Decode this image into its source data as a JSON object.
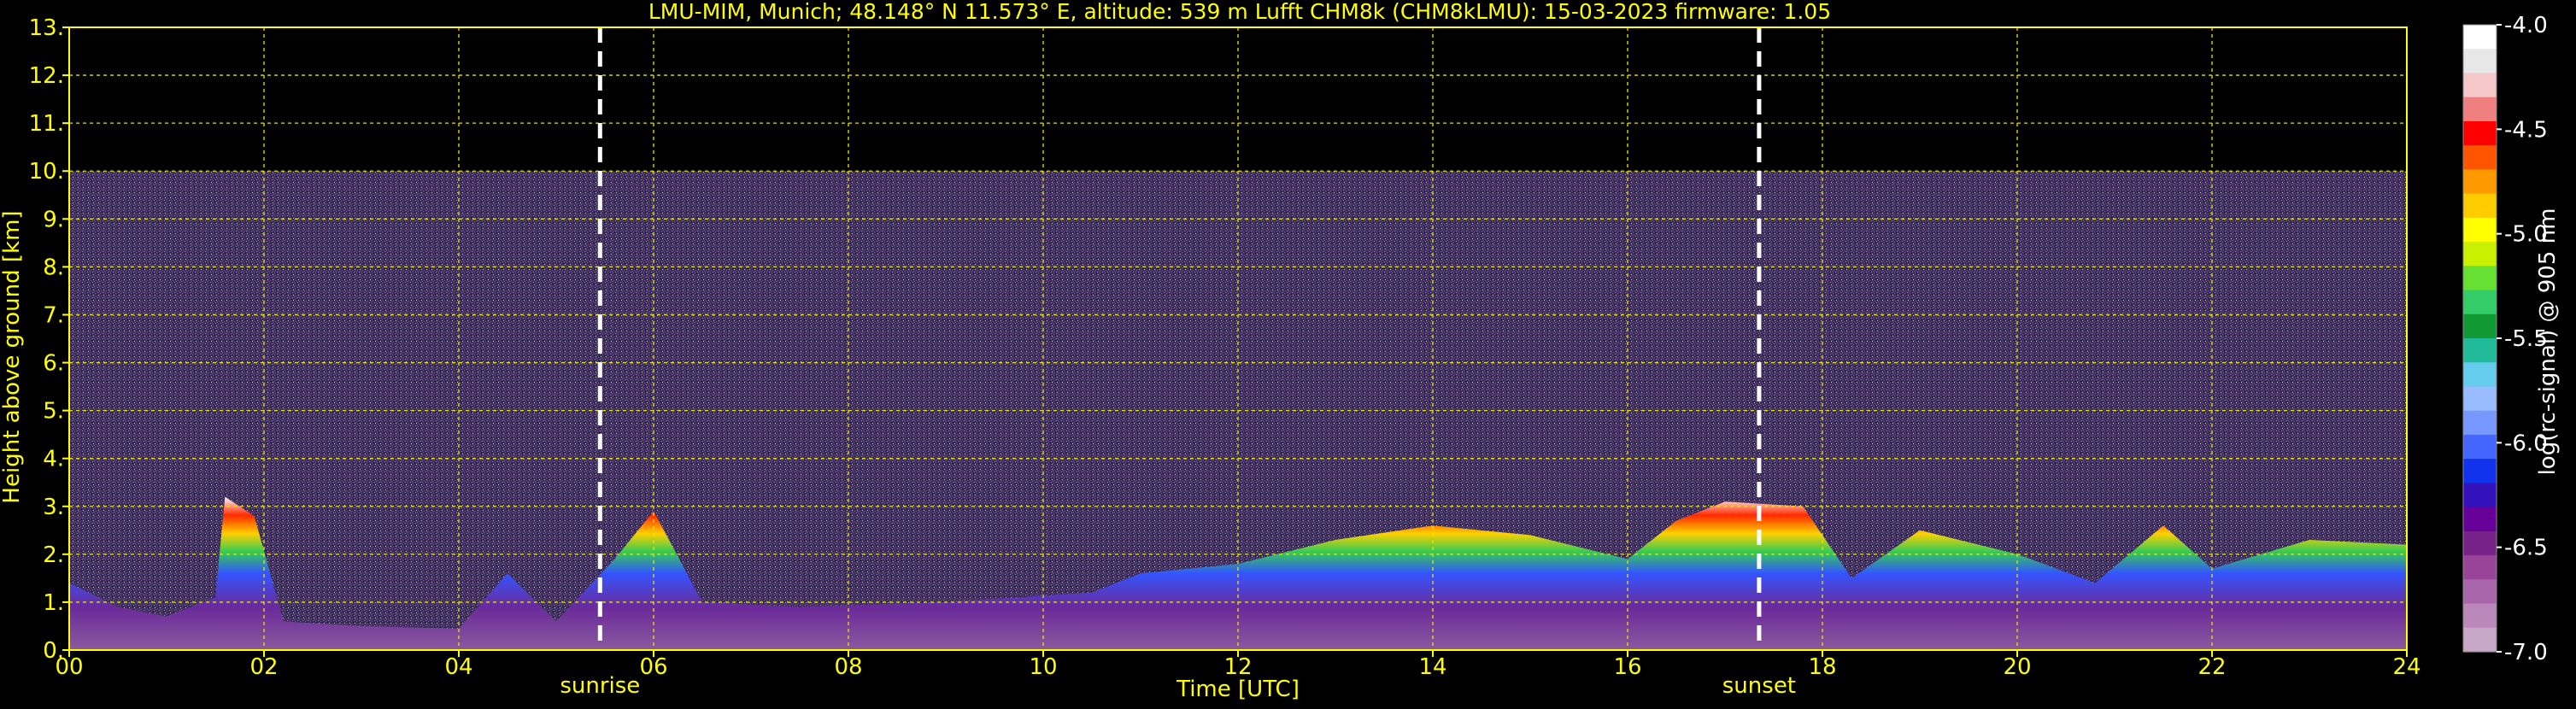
{
  "chart_data": {
    "type": "heatmap",
    "title": "LMU-MIM, Munich; 48.148° N 11.573° E, altitude: 539 m    Lufft CHM8k (CHM8kLMU): 15-03-2023    firmware: 1.05",
    "xlabel": "Time [UTC]",
    "ylabel": "Height above ground [km]",
    "xlim": [
      0,
      24
    ],
    "ylim": [
      0,
      13
    ],
    "x_ticks": [
      "00",
      "02",
      "04",
      "06",
      "08",
      "10",
      "12",
      "14",
      "16",
      "18",
      "20",
      "22",
      "24"
    ],
    "y_ticks": [
      "0.",
      "1.",
      "2.",
      "3.",
      "4.",
      "5.",
      "6.",
      "7.",
      "8.",
      "9.",
      "10.",
      "11.",
      "12.",
      "13."
    ],
    "grid": true,
    "grid_color": "#e6e600",
    "text_color": "#ffff00",
    "background": "#000000",
    "signal_top_km": 10,
    "annotations": [
      {
        "label": "sunrise",
        "x": 5.45
      },
      {
        "label": "sunset",
        "x": 17.35
      }
    ],
    "colorbar": {
      "label": "log(rc-signal) @ 905 nm",
      "range": [
        -7.0,
        -4.0
      ],
      "ticks": [
        "-4.0",
        "-4.5",
        "-5.0",
        "-5.5",
        "-6.0",
        "-6.5",
        "-7.0"
      ],
      "colors": [
        "#ffffff",
        "#e8e8e8",
        "#f4c8c8",
        "#f08080",
        "#ff0000",
        "#ff5500",
        "#ff9900",
        "#ffcc00",
        "#ffff00",
        "#c8f000",
        "#66e033",
        "#33cc66",
        "#119933",
        "#22bb99",
        "#66ccee",
        "#99bbff",
        "#7799ff",
        "#4466ff",
        "#1133ee",
        "#3311bb",
        "#660099",
        "#772288",
        "#994499",
        "#aa66aa",
        "#bb88bb",
        "#c8a8c8"
      ]
    },
    "boundary_layer_profile": [
      {
        "x": 0.0,
        "top": 1.4
      },
      {
        "x": 0.5,
        "top": 0.9
      },
      {
        "x": 1.0,
        "top": 0.7
      },
      {
        "x": 1.5,
        "top": 1.1
      },
      {
        "x": 1.6,
        "top": 3.2
      },
      {
        "x": 1.9,
        "top": 2.8
      },
      {
        "x": 2.2,
        "top": 0.6
      },
      {
        "x": 3.0,
        "top": 0.5
      },
      {
        "x": 4.0,
        "top": 0.45
      },
      {
        "x": 4.5,
        "top": 1.6
      },
      {
        "x": 5.0,
        "top": 0.6
      },
      {
        "x": 5.6,
        "top": 1.9
      },
      {
        "x": 6.0,
        "top": 2.9
      },
      {
        "x": 6.5,
        "top": 1.0
      },
      {
        "x": 7.5,
        "top": 0.9
      },
      {
        "x": 9.0,
        "top": 1.0
      },
      {
        "x": 10.5,
        "top": 1.2
      },
      {
        "x": 11.0,
        "top": 1.6
      },
      {
        "x": 12.0,
        "top": 1.8
      },
      {
        "x": 13.0,
        "top": 2.3
      },
      {
        "x": 14.0,
        "top": 2.6
      },
      {
        "x": 15.0,
        "top": 2.4
      },
      {
        "x": 16.0,
        "top": 1.9
      },
      {
        "x": 16.5,
        "top": 2.7
      },
      {
        "x": 17.0,
        "top": 3.1
      },
      {
        "x": 17.8,
        "top": 3.0
      },
      {
        "x": 18.3,
        "top": 1.5
      },
      {
        "x": 19.0,
        "top": 2.5
      },
      {
        "x": 20.0,
        "top": 2.0
      },
      {
        "x": 20.8,
        "top": 1.4
      },
      {
        "x": 21.5,
        "top": 2.6
      },
      {
        "x": 22.0,
        "top": 1.7
      },
      {
        "x": 23.0,
        "top": 2.3
      },
      {
        "x": 24.0,
        "top": 2.2
      }
    ]
  }
}
